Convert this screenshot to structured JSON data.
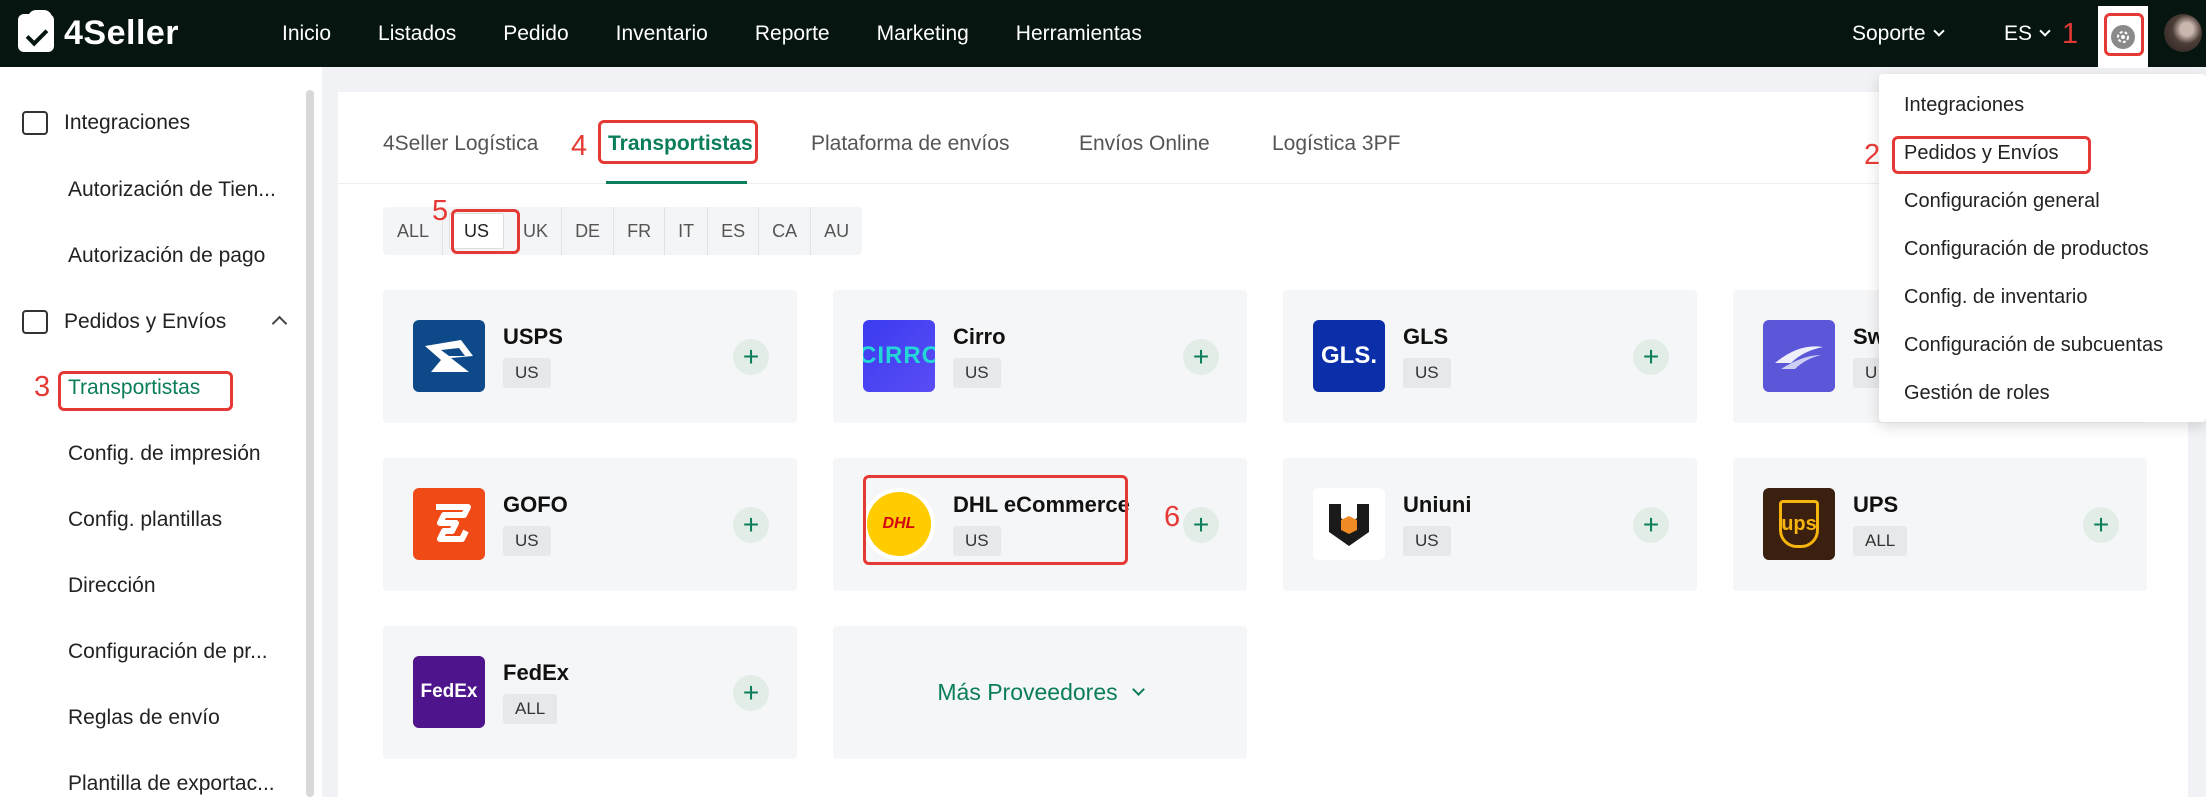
{
  "brand": {
    "name": "4Seller"
  },
  "nav": {
    "items": [
      "Inicio",
      "Listados",
      "Pedido",
      "Inventario",
      "Reporte",
      "Marketing",
      "Herramientas"
    ]
  },
  "topright": {
    "support": "Soporte",
    "language": "ES"
  },
  "sidebar": {
    "group1": "Integraciones",
    "group1_items": [
      "Autorización de Tien...",
      "Autorización de pago"
    ],
    "group2": "Pedidos y Envíos",
    "group2_items": [
      "Transportistas",
      "Config. de impresión",
      "Config. plantillas",
      "Dirección",
      "Configuración de pr...",
      "Reglas de envío",
      "Plantilla de exportac..."
    ]
  },
  "tabs": [
    "4Seller Logística",
    "Transportistas",
    "Plataforma de envíos",
    "Envíos Online",
    "Logística 3PF"
  ],
  "regions": [
    "ALL",
    "US",
    "UK",
    "DE",
    "FR",
    "IT",
    "ES",
    "CA",
    "AU"
  ],
  "carriers": [
    {
      "name": "USPS",
      "region": "US"
    },
    {
      "name": "Cirro",
      "region": "US"
    },
    {
      "name": "GLS",
      "region": "US"
    },
    {
      "name": "Sw",
      "region": "U"
    },
    {
      "name": "GOFO",
      "region": "US"
    },
    {
      "name": "DHL eCommerce",
      "region": "US"
    },
    {
      "name": "Uniuni",
      "region": "US"
    },
    {
      "name": "UPS",
      "region": "ALL"
    },
    {
      "name": "FedEx",
      "region": "ALL"
    }
  ],
  "more_providers": "Más Proveedores",
  "logo_text": {
    "cirro": "CIRRO",
    "gls": "GLS.",
    "ups": "ups",
    "fedex": "FedEx",
    "dhl": "DHL"
  },
  "dropdown": [
    "Integraciones",
    "Pedidos y Envíos",
    "Configuración general",
    "Configuración de productos",
    "Config. de inventario",
    "Configuración de subcuentas",
    "Gestión de roles"
  ],
  "annotations": [
    "1",
    "2",
    "3",
    "4",
    "5",
    "6"
  ],
  "colors": {
    "accent": "#0a7d5a",
    "highlight": "#e53935",
    "topbar": "#06150f"
  }
}
